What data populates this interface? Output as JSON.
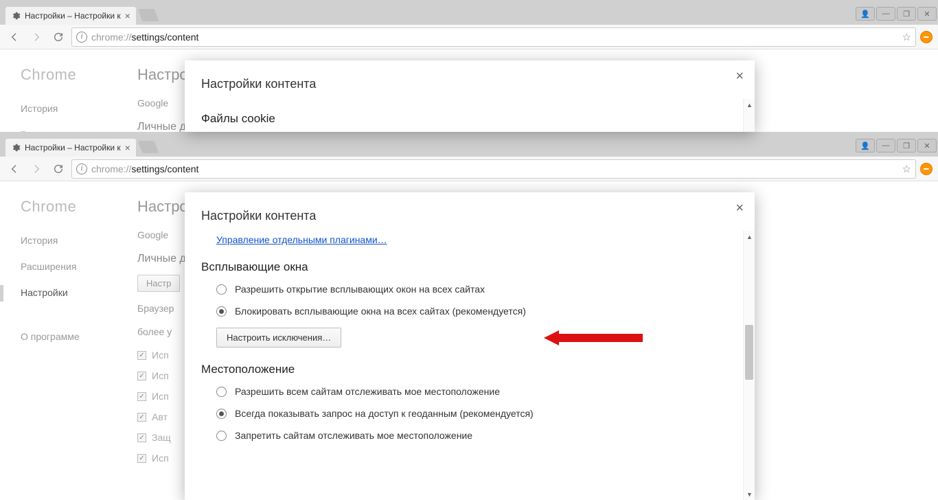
{
  "tab_title": "Настройки – Настройки к",
  "url_grey": "chrome://",
  "url_rest": "settings/content",
  "winbtns": [
    "👤",
    "—",
    "❐",
    "✕"
  ],
  "logo": "Chrome",
  "sidebar": {
    "items": [
      "История",
      "Расширения",
      "Настройки",
      "О программе"
    ],
    "active_index": 2
  },
  "page": {
    "title": "Настрой",
    "google_row": "Google",
    "personal_heading": "Личные д",
    "browser_row": "Браузер",
    "more_row": "более у",
    "default_btn": "Настр",
    "checks": [
      "Исп",
      "Исп",
      "Исп",
      "Авт",
      "Защ",
      "Исп"
    ]
  },
  "modal_top": {
    "title": "Настройки контента",
    "section": "Файлы cookie"
  },
  "modal": {
    "title": "Настройки контента",
    "plugins_link": "Управление отдельными плагинами…",
    "popups": {
      "heading": "Всплывающие окна",
      "allow": "Разрешить открытие всплывающих окон на всех сайтах",
      "block": "Блокировать всплывающие окна на всех сайтах (рекомендуется)",
      "exceptions": "Настроить исключения…"
    },
    "location": {
      "heading": "Местоположение",
      "allow": "Разрешить всем сайтам отслеживать мое местоположение",
      "ask": "Всегда показывать запрос на доступ к геоданным (рекомендуется)",
      "deny": "Запретить сайтам отслеживать мое местоположение"
    }
  }
}
